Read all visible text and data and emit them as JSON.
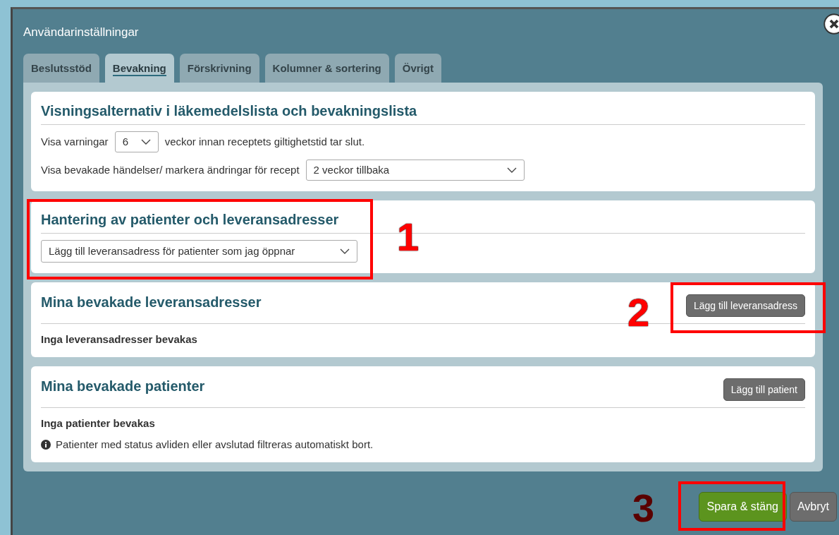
{
  "dialog": {
    "title": "Användarinställningar"
  },
  "tabs": [
    {
      "label": "Beslutsstöd",
      "selected": false
    },
    {
      "label": "Bevakning",
      "selected": true
    },
    {
      "label": "Förskrivning",
      "selected": false
    },
    {
      "label": "Kolumner & sortering",
      "selected": false
    },
    {
      "label": "Övrigt",
      "selected": false
    }
  ],
  "sections": [
    {
      "title": "Visningsalternativ i läkemedelslista och bevakningslista",
      "rows": [
        {
          "kind": "select-row",
          "label": "Visa varningar",
          "value": "6",
          "suffix": "veckor innan receptets giltighetstid tar slut."
        },
        {
          "kind": "select-row",
          "label": "Visa bevakade händelser/ markera ändringar för recept",
          "value": "2 veckor tillbaka"
        }
      ]
    },
    {
      "title": "Hantering av patienter och leveransadresser",
      "rows": [
        {
          "kind": "select",
          "value": "Lägg till leveransadress för patienter som jag öppnar"
        }
      ]
    },
    {
      "title": "Mina bevakade leveransadresser",
      "button": "Lägg till leveransadress",
      "rows": [
        {
          "kind": "bold-text",
          "text": "Inga leveransadresser bevakas"
        }
      ]
    },
    {
      "title": "Mina bevakade patienter",
      "button": "Lägg till patient",
      "rows": [
        {
          "kind": "bold-text",
          "text": "Inga patienter bevakas"
        },
        {
          "kind": "info",
          "text": "Patienter med status avliden eller avslutad filtreras automatiskt bort."
        }
      ]
    }
  ],
  "footer": {
    "buttons": [
      {
        "label": "Spara & stäng",
        "kind": "primary"
      },
      {
        "label": "Avbryt",
        "kind": "secondary"
      }
    ]
  },
  "annotations": [
    {
      "number": "1"
    },
    {
      "number": "2"
    },
    {
      "number": "3"
    }
  ]
}
